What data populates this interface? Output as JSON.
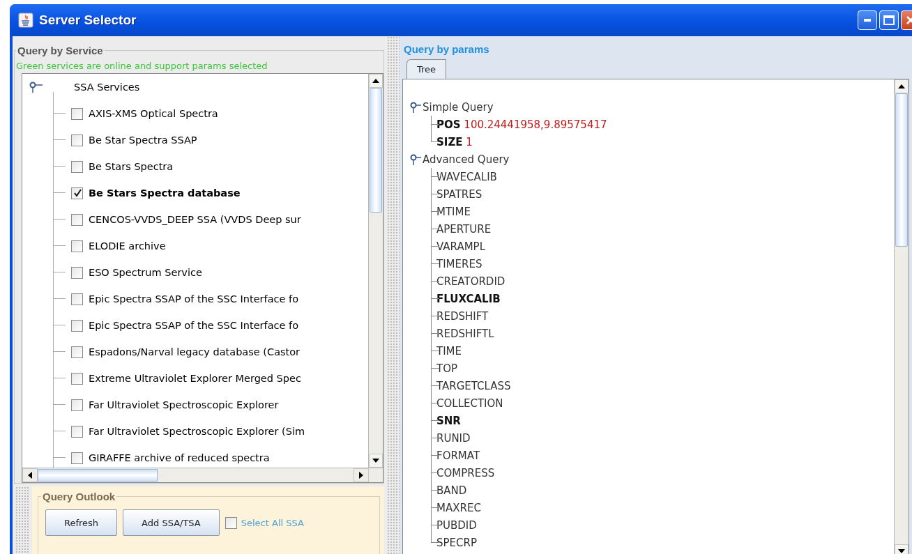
{
  "window": {
    "title": "Server Selector"
  },
  "service_panel": {
    "title": "Query by Service",
    "note": "Green services are online and support params selected",
    "tree": {
      "label": "SSA Services",
      "expanded": true,
      "children": [
        {
          "label": "AXIS-XMS Optical Spectra",
          "checked": false
        },
        {
          "label": "Be Star Spectra SSAP",
          "checked": false
        },
        {
          "label": "Be Stars Spectra",
          "checked": false
        },
        {
          "label": "Be Stars Spectra database",
          "checked": true
        },
        {
          "label": "CENCOS-VVDS_DEEP SSA (VVDS Deep sur",
          "checked": false
        },
        {
          "label": "ELODIE archive",
          "checked": false
        },
        {
          "label": "ESO Spectrum Service",
          "checked": false
        },
        {
          "label": "Epic Spectra SSAP of the SSC Interface fo",
          "checked": false
        },
        {
          "label": "Epic Spectra SSAP of the SSC Interface fo",
          "checked": false
        },
        {
          "label": "Espadons/Narval legacy database (Castor",
          "checked": false
        },
        {
          "label": "Extreme Ultraviolet Explorer Merged Spec",
          "checked": false
        },
        {
          "label": "Far Ultraviolet Spectroscopic Explorer",
          "checked": false
        },
        {
          "label": "Far Ultraviolet Spectroscopic Explorer (Sim",
          "checked": false
        },
        {
          "label": "GIRAFFE archive of reduced spectra",
          "checked": false
        }
      ]
    },
    "outlook": {
      "title": "Query Outlook",
      "buttons": [
        "Refresh",
        "Add SSA/TSA"
      ],
      "select_all": {
        "label": "Select All SSA",
        "checked": false
      }
    }
  },
  "params_panel": {
    "title": "Query by params",
    "tabs": [
      {
        "label": "Tree",
        "selected": true
      }
    ],
    "tree": [
      {
        "label": "Simple Query",
        "expanded": true,
        "children": [
          {
            "name": "POS",
            "value": "100.24441958,9.89575417",
            "bold": true
          },
          {
            "name": "SIZE",
            "value": "1",
            "bold": true
          }
        ]
      },
      {
        "label": "Advanced Query",
        "expanded": true,
        "children": [
          {
            "name": "WAVECALIB",
            "bold": false
          },
          {
            "name": "SPATRES",
            "bold": false
          },
          {
            "name": "MTIME",
            "bold": false
          },
          {
            "name": "APERTURE",
            "bold": false
          },
          {
            "name": "VARAMPL",
            "bold": false
          },
          {
            "name": "TIMERES",
            "bold": false
          },
          {
            "name": "CREATORDID",
            "bold": false
          },
          {
            "name": "FLUXCALIB",
            "bold": true
          },
          {
            "name": "REDSHIFT",
            "bold": false
          },
          {
            "name": "REDSHIFTL",
            "bold": false
          },
          {
            "name": "TIME",
            "bold": false
          },
          {
            "name": "TOP",
            "bold": false
          },
          {
            "name": "TARGETCLASS",
            "bold": false
          },
          {
            "name": "COLLECTION",
            "bold": false
          },
          {
            "name": "SNR",
            "bold": true
          },
          {
            "name": "RUNID",
            "bold": false
          },
          {
            "name": "FORMAT",
            "bold": false
          },
          {
            "name": "COMPRESS",
            "bold": false
          },
          {
            "name": "BAND",
            "bold": false
          },
          {
            "name": "MAXREC",
            "bold": false
          },
          {
            "name": "PUBDID",
            "bold": false
          },
          {
            "name": "SPECRP",
            "bold": false
          }
        ]
      }
    ]
  }
}
